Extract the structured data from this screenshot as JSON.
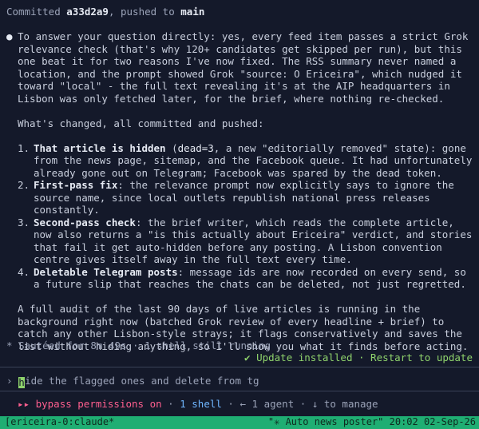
{
  "header": {
    "prefix": "Committed ",
    "hash": "a33d2a9",
    "mid": ", pushed to ",
    "branch": "main"
  },
  "bullet_glyph": "●",
  "intro": "To answer your question directly: yes, every feed item passes a strict Grok relevance check (that's why 120+ candidates get skipped per run), but this one beat it for two reasons I've now fixed. The RSS summary never named a location, and the prompt showed Grok \"source: O Ericeira\", which nudged it toward \"local\" - the full text revealing it's at the AIP headquarters in Lisbon was only fetched later, for the brief, where nothing re-checked.",
  "changes_heading": "What's changed, all committed and pushed:",
  "changes": [
    {
      "num": "1.",
      "title": "That article is hidden",
      "pre": " (",
      "code": "dead=3",
      "text": ", a new \"editorially removed\" state): gone from the news page, sitemap, and the Facebook queue. It had unfortunately already gone out on Telegram; Facebook was spared by the dead token."
    },
    {
      "num": "2.",
      "title": "First-pass fix",
      "pre": "",
      "code": "",
      "text": ": the relevance prompt now explicitly says to ignore the source name, since local outlets republish national press releases constantly."
    },
    {
      "num": "3.",
      "title": "Second-pass check",
      "pre": "",
      "code": "",
      "text": ": the brief writer, which reads the complete article, now also returns a \"is this actually about Ericeira\" verdict, and stories that fail it get auto-hidden before any posting. A Lisbon convention centre gives itself away in the full text every time."
    },
    {
      "num": "4.",
      "title": "Deletable Telegram posts",
      "pre": "",
      "code": "",
      "text": ": message ids are now recorded on every send, so a future slip that reaches the chats can be deleted, not just regretted."
    }
  ],
  "audit": "A full audit of the last 90 days of live articles is running in the background right now (batched Grok review of every headline + brief) to catch any other Lisbon-style strays; it flags conservatively and saves the list without hiding anything, so I'll show you what it finds before acting.",
  "status": {
    "glyph": "*",
    "text": "Sautéed for 8m 49s · 1 shell still running"
  },
  "update": {
    "check": "✔",
    "text": "Update installed · Restart to update"
  },
  "prompt": {
    "chevron": "›",
    "cursor_char": "h",
    "value": "ide the flagged ones and delete from tg"
  },
  "permissions": {
    "arrows": "▸▸",
    "mode": "bypass permissions on",
    "sep1": " · ",
    "shells": "1 shell",
    "rest": " · ← 1 agent · ↓ to manage"
  },
  "tmux": {
    "left": "[ericeira-0:claude*",
    "right": "\"✳ Auto news poster\" 20:02 02-Sep-26"
  },
  "colors": {
    "background": "#14192a",
    "text": "#c9cfdd",
    "accent_green": "#8fd36c",
    "accent_blue": "#6fb6ff",
    "accent_pink": "#ff5f8f",
    "tmux_bar": "#1fae73"
  }
}
